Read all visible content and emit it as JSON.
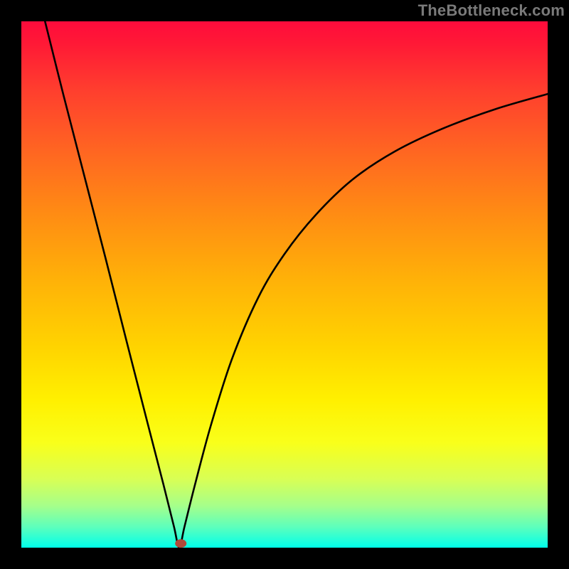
{
  "attribution": "TheBottleneck.com",
  "chart_data": {
    "type": "line",
    "title": "",
    "xlabel": "",
    "ylabel": "",
    "xlim": [
      0,
      100
    ],
    "ylim": [
      0,
      100
    ],
    "minimum": {
      "x": 30.0,
      "y": 0
    },
    "marker": {
      "x": 30.3,
      "y": 0.8,
      "color": "#b04a3a"
    },
    "series": [
      {
        "name": "curve",
        "x": [
          4.5,
          8,
          12,
          16,
          20,
          24,
          27,
          29,
          30,
          31,
          33,
          36,
          40,
          45,
          50,
          56,
          63,
          71,
          80,
          90,
          100
        ],
        "values": [
          100,
          86,
          70.5,
          55,
          39.2,
          23.6,
          12,
          4,
          0,
          4,
          12,
          23.2,
          35.8,
          47.5,
          55.8,
          63.3,
          70,
          75.3,
          79.6,
          83.3,
          86.2
        ]
      }
    ],
    "background_gradient": {
      "top": "#ff0b3c",
      "mid": "#ffd400",
      "bottom": "#00ffe8"
    }
  }
}
